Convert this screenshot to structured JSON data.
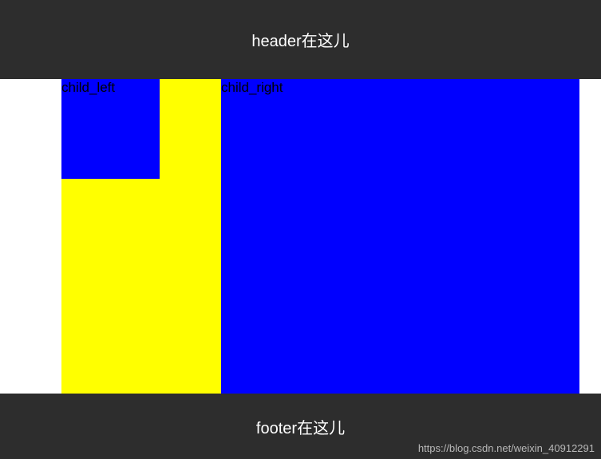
{
  "header": {
    "title": "header在这儿"
  },
  "main": {
    "child_left_label": "child_left",
    "child_right_label": "child_right"
  },
  "footer": {
    "title": "footer在这儿",
    "watermark": "https://blog.csdn.net/weixin_40912291"
  },
  "colors": {
    "header_bg": "#2d2d2d",
    "footer_bg": "#2d2d2d",
    "blue": "#0000ff",
    "yellow": "#ffff00",
    "white": "#ffffff"
  }
}
